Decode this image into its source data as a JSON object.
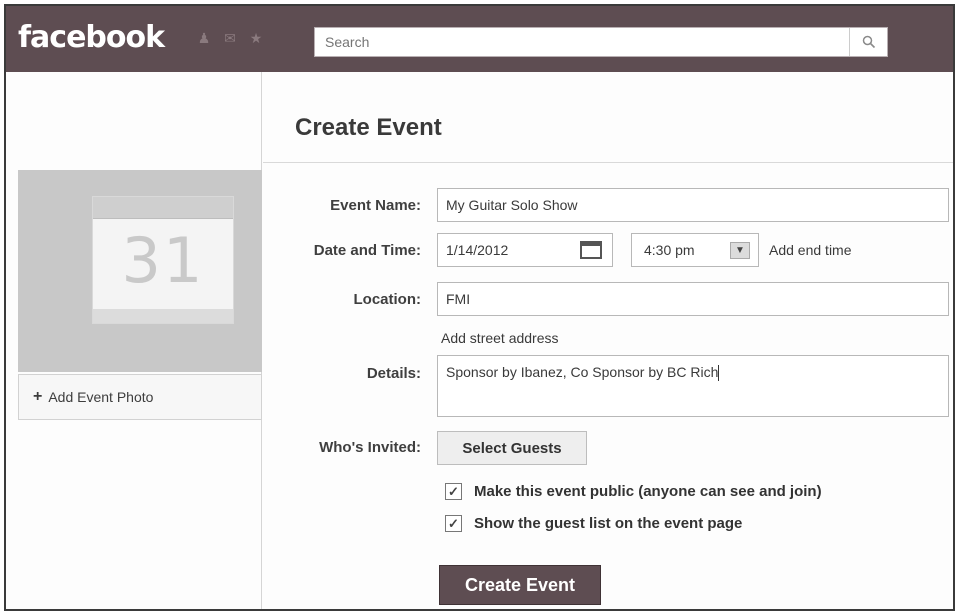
{
  "header": {
    "logo": "facebook",
    "search_placeholder": "Search"
  },
  "sidebar": {
    "calendar_number": "31",
    "add_photo_label": "Add Event Photo"
  },
  "form": {
    "title": "Create Event",
    "event_name_label": "Event Name:",
    "event_name_value": "My Guitar Solo Show",
    "date_time_label": "Date and Time:",
    "date_value": "1/14/2012",
    "time_value": "4:30 pm",
    "add_end_time": "Add end time",
    "location_label": "Location:",
    "location_value": "FMI",
    "add_street_address": "Add street address",
    "details_label": "Details:",
    "details_value": "Sponsor by Ibanez, Co Sponsor by BC Rich",
    "invited_label": "Who's Invited:",
    "select_guests": "Select Guests",
    "public_option": "Make this event public (anyone can see and join)",
    "guest_list_option": "Show the guest list on the event page",
    "public_checked": true,
    "guest_list_checked": true,
    "create_button": "Create Event"
  },
  "colors": {
    "header_bg": "#5e4d52",
    "button_bg": "#5e4d52"
  }
}
